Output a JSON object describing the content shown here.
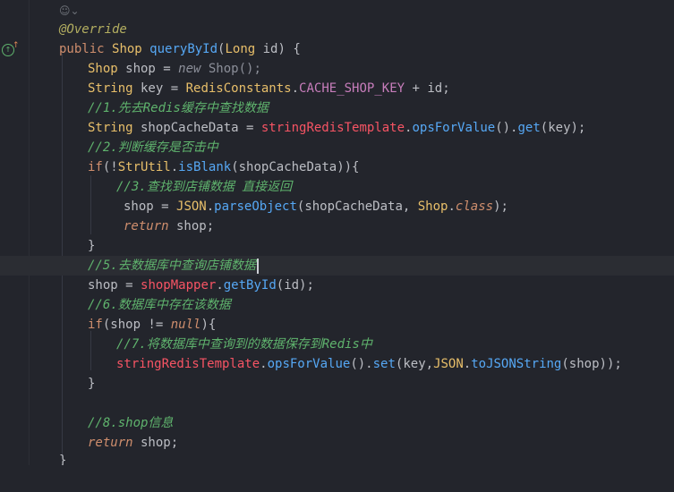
{
  "icons": {
    "inlay_hint": "author-hint-icon",
    "override_marker": "override-gutter-icon"
  },
  "lines": {
    "l1": {
      "annotation": "@Override"
    },
    "l2": {
      "kw_public": "public",
      "type": "Shop",
      "fn": "queryById",
      "open": "(",
      "ptype": "Long",
      "pname": " id",
      "close": ") {"
    },
    "l3": {
      "type": "Shop",
      "rest": " shop = ",
      "kw_new": "new",
      "ctor": " Shop",
      "parens": "();"
    },
    "l4": {
      "type": "String",
      "rest": " key = ",
      "cls": "RedisConstants",
      "dot": ".",
      "field": "CACHE_SHOP_KEY",
      "tail": " + id;"
    },
    "l5": {
      "comment": "//1.先去Redis缓存中查找数据"
    },
    "l6": {
      "type": "String",
      "rest": " shopCacheData = ",
      "var": "stringRedisTemplate",
      "dot1": ".",
      "fn1": "opsForValue",
      "mid": "().",
      "fn2": "get",
      "tail": "(key);"
    },
    "l7": {
      "comment": "//2.判断缓存是否击中"
    },
    "l8": {
      "kw_if": "if",
      "open": "(!",
      "cls": "StrUtil",
      "dot": ".",
      "fn": "isBlank",
      "tail": "(shopCacheData)){"
    },
    "l9": {
      "comment": "//3.查找到店铺数据 直接返回"
    },
    "l10": {
      "rest": "shop = ",
      "cls": "JSON",
      "dot": ".",
      "fn": "parseObject",
      "mid": "(shopCacheData, ",
      "cls2": "Shop",
      "dot2": ".",
      "kw_class": "class",
      "tail": ");"
    },
    "l11": {
      "kw_return": "return",
      "tail": " shop;"
    },
    "l12": {
      "brace": "}"
    },
    "l13": {
      "comment": "//5.去数据库中查询店铺数据"
    },
    "l14": {
      "rest": "shop = ",
      "var": "shopMapper",
      "dot": ".",
      "fn": "getById",
      "tail": "(id);"
    },
    "l15": {
      "comment": "//6.数据库中存在该数据"
    },
    "l16": {
      "kw_if": "if",
      "mid": "(shop != ",
      "kw_null": "null",
      "tail": "){"
    },
    "l17": {
      "comment": "//7.将数据库中查询到的数据保存到Redis中"
    },
    "l18": {
      "var": "stringRedisTemplate",
      "dot1": ".",
      "fn1": "opsForValue",
      "mid1": "().",
      "fn2": "set",
      "mid2": "(key,",
      "cls": "JSON",
      "dot2": ".",
      "fn3": "toJSONString",
      "tail": "(shop));"
    },
    "l19": {
      "brace": "}"
    },
    "l21": {
      "comment": "//8.shop信息"
    },
    "l22": {
      "kw_return": "return",
      "tail": " shop;"
    },
    "l23": {
      "brace": "}"
    }
  },
  "colors": {
    "background": "#23252c",
    "keyword": "#cf8e6d",
    "type": "#e8bf6a",
    "function": "#56a8f5",
    "field": "#c77dbb",
    "comment": "#5fb36d",
    "annotation": "#b3ae60",
    "red_var": "#f75464"
  }
}
